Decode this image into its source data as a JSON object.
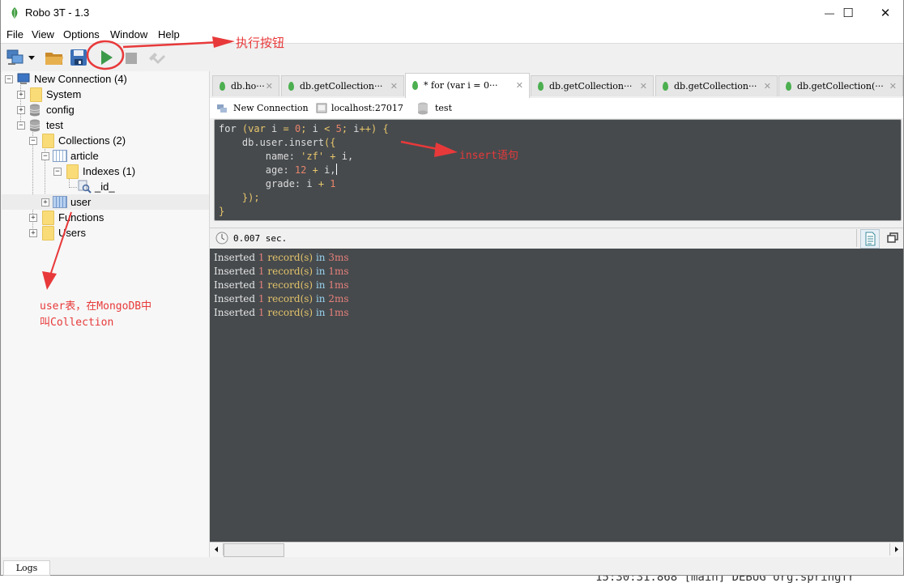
{
  "window": {
    "title": "Robo 3T - 1.3",
    "controls": {
      "minimize": "—",
      "maximize": "☐",
      "close": "✕"
    }
  },
  "menu": [
    "File",
    "View",
    "Options",
    "Window",
    "Help"
  ],
  "toolbar": {
    "buttons": [
      "connect-icon",
      "dropdown-icon",
      "open-folder-icon",
      "save-icon",
      "execute-icon",
      "stop-icon",
      "interrupt-icon"
    ]
  },
  "explorer": {
    "connection": "New Connection (4)",
    "system": "System",
    "config": "config",
    "test": "test",
    "collections": "Collections (2)",
    "article": "article",
    "indexes": "Indexes (1)",
    "index_id": "_id_",
    "user": "user",
    "functions": "Functions",
    "users": "Users"
  },
  "tabs": [
    {
      "label": "db.ho···",
      "active": false
    },
    {
      "label": "db.getCollection···",
      "active": false
    },
    {
      "label": "* for (var i = 0···",
      "active": true
    },
    {
      "label": "db.getCollection···",
      "active": false
    },
    {
      "label": "db.getCollection···",
      "active": false
    },
    {
      "label": "db.getCollection(···",
      "active": false
    }
  ],
  "context": {
    "connection": "New Connection",
    "host": "localhost:27017",
    "database": "test"
  },
  "editor": {
    "lines": [
      "for (var i = 0; i < 5; i++) {",
      "    db.user.insert({",
      "        name: 'zf' + i,",
      "        age: 12 + i,",
      "        grade: i + 1",
      "    });",
      "}"
    ]
  },
  "results": {
    "elapsed": "0.007 sec.",
    "lines": [
      {
        "word": "Inserted",
        "count": "1",
        "unit": "record(s)",
        "in": "in",
        "time": "3ms"
      },
      {
        "word": "Inserted",
        "count": "1",
        "unit": "record(s)",
        "in": "in",
        "time": "1ms"
      },
      {
        "word": "Inserted",
        "count": "1",
        "unit": "record(s)",
        "in": "in",
        "time": "1ms"
      },
      {
        "word": "Inserted",
        "count": "1",
        "unit": "record(s)",
        "in": "in",
        "time": "2ms"
      },
      {
        "word": "Inserted",
        "count": "1",
        "unit": "record(s)",
        "in": "in",
        "time": "1ms"
      }
    ]
  },
  "logs_tab": "Logs",
  "annotations": {
    "execute": "执行按钮",
    "insert": "insert语句",
    "user_line1": "user表，在MongoDB中",
    "user_line2": "叫Collection",
    "color": "#e8393a"
  },
  "background_text": "15:30:31.868 [main] DEBUG org.springfr"
}
